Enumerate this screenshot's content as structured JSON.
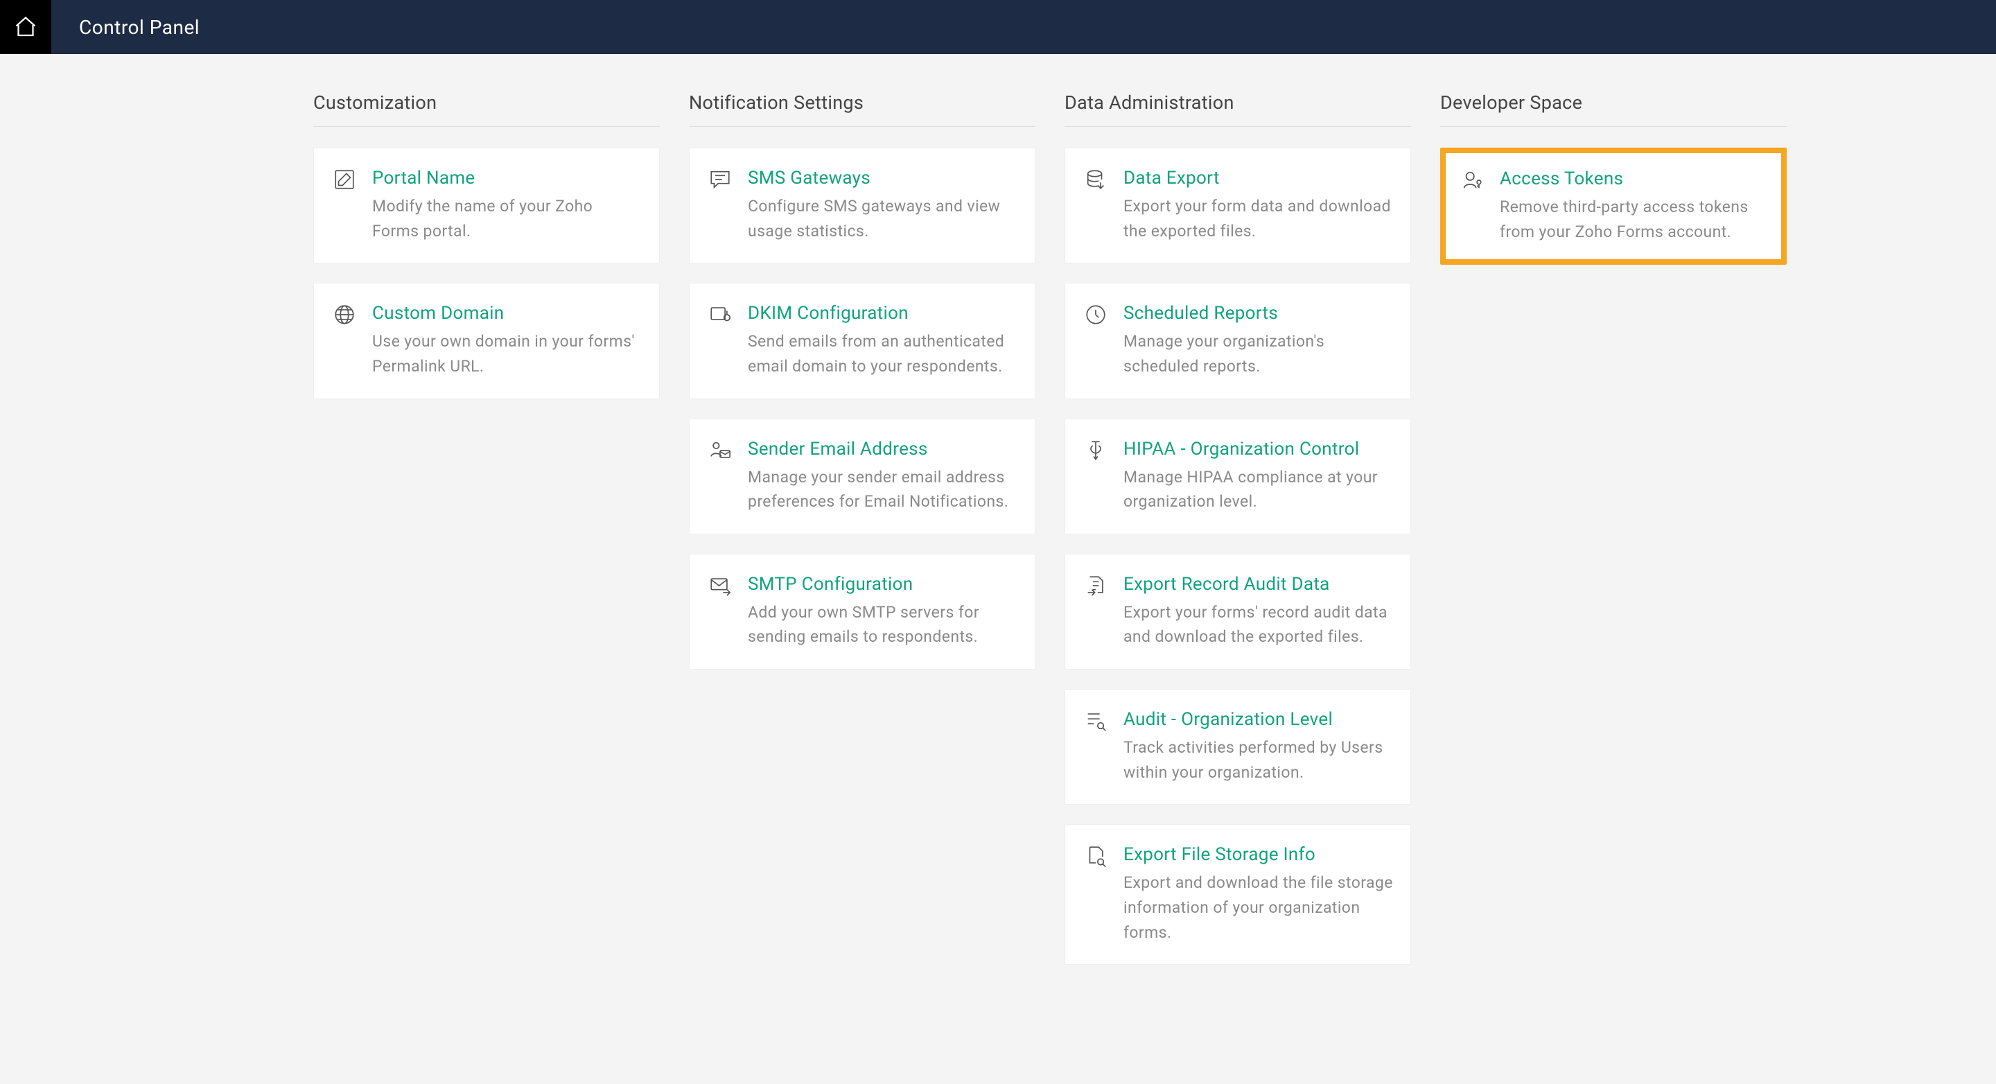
{
  "header": {
    "title": "Control Panel"
  },
  "columns": [
    {
      "title": "Customization",
      "cards": [
        {
          "icon": "edit",
          "title": "Portal Name",
          "desc": "Modify the name of your Zoho Forms portal."
        },
        {
          "icon": "globe",
          "title": "Custom Domain",
          "desc": "Use your own domain in your forms' Permalink URL."
        }
      ]
    },
    {
      "title": "Notification Settings",
      "cards": [
        {
          "icon": "chat",
          "title": "SMS Gateways",
          "desc": "Configure SMS gateways and view usage statistics."
        },
        {
          "icon": "key",
          "title": "DKIM Configuration",
          "desc": "Send emails from an authenticated email domain to your respondents."
        },
        {
          "icon": "user-mail",
          "title": "Sender Email Address",
          "desc": "Manage your sender email address preferences for Email Notifications."
        },
        {
          "icon": "mail-arrow",
          "title": "SMTP Configuration",
          "desc": "Add your own SMTP servers for sending emails to respondents."
        }
      ]
    },
    {
      "title": "Data Administration",
      "cards": [
        {
          "icon": "db",
          "title": "Data Export",
          "desc": "Export your form data and download the exported files."
        },
        {
          "icon": "clock",
          "title": "Scheduled Reports",
          "desc": "Manage your organization's scheduled reports."
        },
        {
          "icon": "medical",
          "title": "HIPAA - Organization Control",
          "desc": "Manage HIPAA compliance at your organization level."
        },
        {
          "icon": "doc-arrow",
          "title": "Export Record Audit Data",
          "desc": "Export your forms' record audit data and download the exported files."
        },
        {
          "icon": "list-search",
          "title": "Audit - Organization Level",
          "desc": "Track activities performed by Users within your organization."
        },
        {
          "icon": "doc-search",
          "title": "Export File Storage Info",
          "desc": "Export and download the file storage information of your organization forms."
        }
      ]
    },
    {
      "title": "Developer Space",
      "cards": [
        {
          "icon": "user-key",
          "title": "Access Tokens",
          "desc": "Remove third-party access tokens from your Zoho Forms account.",
          "highlight": true
        }
      ]
    }
  ]
}
